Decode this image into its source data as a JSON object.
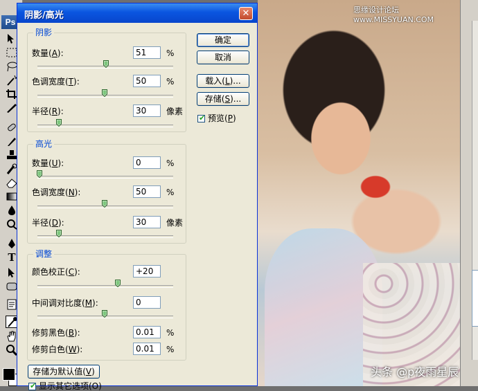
{
  "watermarks": {
    "top": "思缘设计论坛 www.MISSYUAN.COM",
    "bottom": "头条 @p夜雨星辰"
  },
  "toolbox": {
    "logo": "Ps"
  },
  "dialog": {
    "title": "阴影/高光",
    "close_label": "✕",
    "shadows": {
      "legend": "阴影",
      "amount": {
        "label_pre": "数量(",
        "key": "A",
        "label_post": "):",
        "value": "51",
        "unit": "%",
        "slider": 0.51
      },
      "tonal_width": {
        "label_pre": "色调宽度(",
        "key": "T",
        "label_post": "):",
        "value": "50",
        "unit": "%",
        "slider": 0.5
      },
      "radius": {
        "label_pre": "半径(",
        "key": "R",
        "label_post": "):",
        "value": "30",
        "unit": "像素",
        "slider": 0.15
      }
    },
    "highlights": {
      "legend": "高光",
      "amount": {
        "label_pre": "数量(",
        "key": "U",
        "label_post": "):",
        "value": "0",
        "unit": "%",
        "slider": 0.0
      },
      "tonal_width": {
        "label_pre": "色调宽度(",
        "key": "N",
        "label_post": "):",
        "value": "50",
        "unit": "%",
        "slider": 0.5
      },
      "radius": {
        "label_pre": "半径(",
        "key": "D",
        "label_post": "):",
        "value": "30",
        "unit": "像素",
        "slider": 0.15
      }
    },
    "adjustments": {
      "legend": "调整",
      "color_correction": {
        "label_pre": "颜色校正(",
        "key": "C",
        "label_post": "):",
        "value": "+20",
        "slider": 0.6
      },
      "midtone_contrast": {
        "label_pre": "中间调对比度(",
        "key": "M",
        "label_post": "):",
        "value": "0",
        "slider": 0.5
      },
      "black_clip": {
        "label_pre": "修剪黑色(",
        "key": "B",
        "label_post": "):",
        "value": "0.01",
        "unit": "%"
      },
      "white_clip": {
        "label_pre": "修剪白色(",
        "key": "W",
        "label_post": "):",
        "value": "0.01",
        "unit": "%"
      }
    },
    "buttons": {
      "ok": "确定",
      "cancel": "取消",
      "load": {
        "pre": "载入(",
        "key": "L",
        "post": ")..."
      },
      "save": {
        "pre": "存储(",
        "key": "S",
        "post": ")..."
      },
      "save_default": {
        "pre": "存储为默认值(",
        "key": "V",
        "post": ")"
      }
    },
    "preview": {
      "pre": "预览(",
      "key": "P",
      "post": ")",
      "checked": true
    },
    "show_more": {
      "text": "显示其它选项(O)",
      "checked": true
    }
  }
}
